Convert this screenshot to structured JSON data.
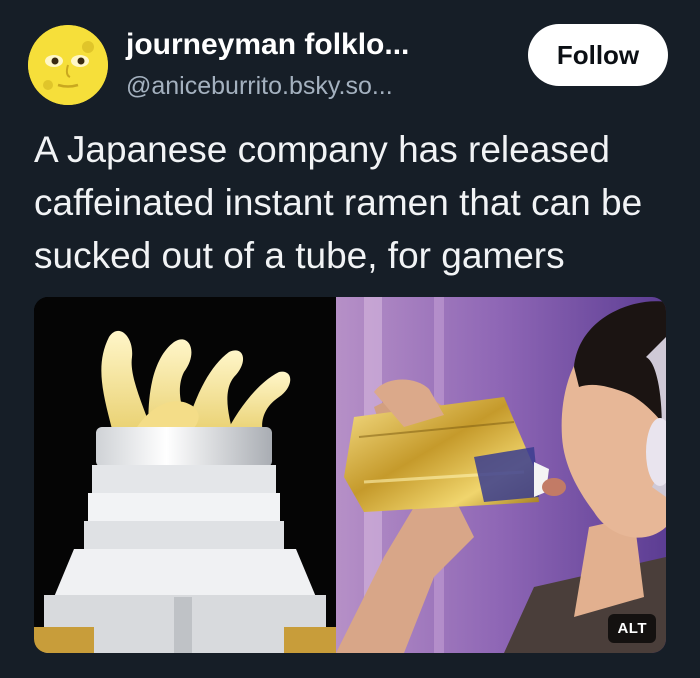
{
  "post": {
    "display_name": "journeyman folklo...",
    "handle": "@aniceburrito.bsky.so...",
    "follow_label": "Follow",
    "text": "A Japanese company has released caffeinated instant ramen that can be sucked out of a tube, for gamers",
    "avatar_icon": "full-moon-face-icon",
    "media": {
      "alt_label": "ALT",
      "panels": [
        "ramen-noodles-in-tube-photo",
        "person-drinking-from-gold-pouch-photo"
      ]
    }
  },
  "colors": {
    "background": "#161e27",
    "avatar": "#f6df3a",
    "follow_button": "#ffffff",
    "handle_text": "#a4b1bf"
  }
}
